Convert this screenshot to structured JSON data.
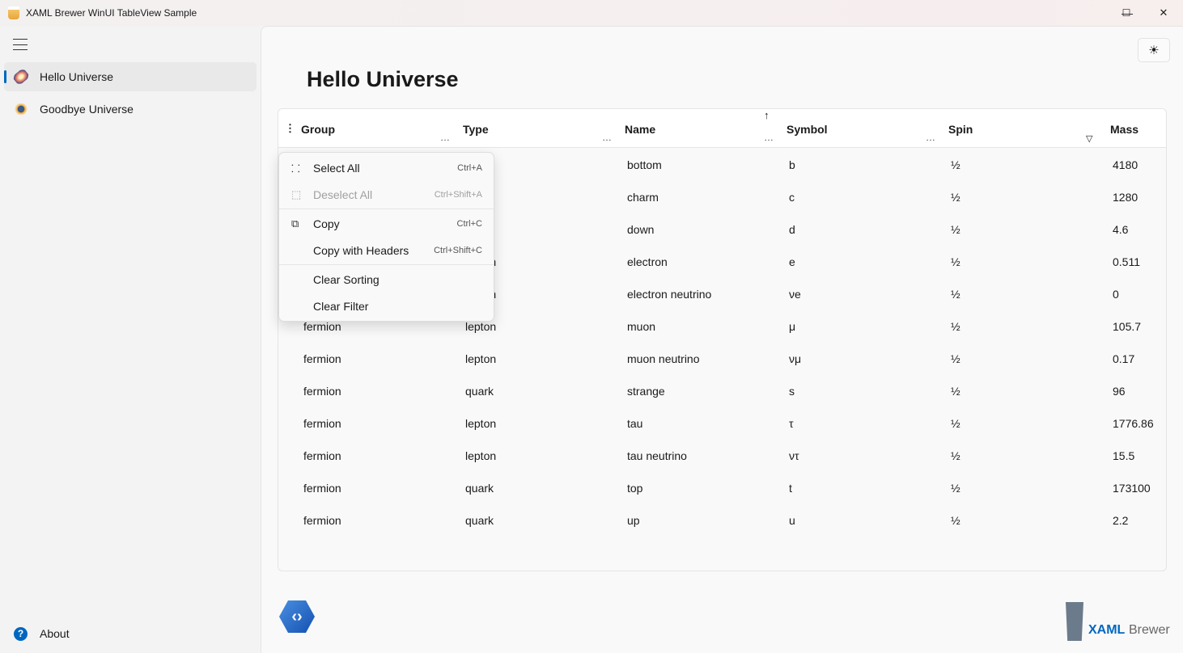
{
  "window": {
    "title": "XAML Brewer WinUI TableView Sample",
    "minimize": "—",
    "maximize": "☐",
    "close": "✕"
  },
  "sidebar": {
    "items": [
      {
        "label": "Hello Universe",
        "selected": true,
        "icon": "galaxy-icon"
      },
      {
        "label": "Goodbye Universe",
        "icon": "planet-icon"
      }
    ],
    "footer": {
      "label": "About",
      "icon": "help-icon"
    }
  },
  "main": {
    "title": "Hello Universe",
    "theme_icon": "☀"
  },
  "table": {
    "columns": [
      {
        "label": "Group"
      },
      {
        "label": "Type"
      },
      {
        "label": "Name",
        "sort": "ascending"
      },
      {
        "label": "Symbol"
      },
      {
        "label": "Spin",
        "filtered": true
      },
      {
        "label": "Mass"
      }
    ],
    "rows": [
      [
        "",
        "",
        "bottom",
        "b",
        "½",
        "4180"
      ],
      [
        "",
        "",
        "charm",
        "c",
        "½",
        "1280"
      ],
      [
        "",
        "",
        "down",
        "d",
        "½",
        "4.6"
      ],
      [
        "",
        "lepton",
        "electron",
        "e",
        "½",
        "0.511"
      ],
      [
        "",
        "lepton",
        "electron neutrino",
        "νe",
        "½",
        "0"
      ],
      [
        "fermion",
        "lepton",
        "muon",
        "μ",
        "½",
        "105.7"
      ],
      [
        "fermion",
        "lepton",
        "muon neutrino",
        "νμ",
        "½",
        "0.17"
      ],
      [
        "fermion",
        "quark",
        "strange",
        "s",
        "½",
        "96"
      ],
      [
        "fermion",
        "lepton",
        "tau",
        "τ",
        "½",
        "1776.86"
      ],
      [
        "fermion",
        "lepton",
        "tau neutrino",
        "ντ",
        "½",
        "15.5"
      ],
      [
        "fermion",
        "quark",
        "top",
        "t",
        "½",
        "173100"
      ],
      [
        "fermion",
        "quark",
        "up",
        "u",
        "½",
        "2.2"
      ]
    ]
  },
  "context_menu": {
    "items": [
      {
        "label": "Select All",
        "shortcut": "Ctrl+A",
        "icon": "select-all-icon"
      },
      {
        "label": "Deselect All",
        "shortcut": "Ctrl+Shift+A",
        "icon": "deselect-all-icon",
        "disabled": true
      },
      {
        "label": "Copy",
        "shortcut": "Ctrl+C",
        "icon": "copy-icon"
      },
      {
        "label": "Copy with Headers",
        "shortcut": "Ctrl+Shift+C"
      },
      {
        "label": "Clear Sorting"
      },
      {
        "label": "Clear Filter"
      }
    ]
  },
  "branding": {
    "logo_text_1": "XAML",
    "logo_text_2": "Brewer",
    "accent": "#0067c0"
  }
}
